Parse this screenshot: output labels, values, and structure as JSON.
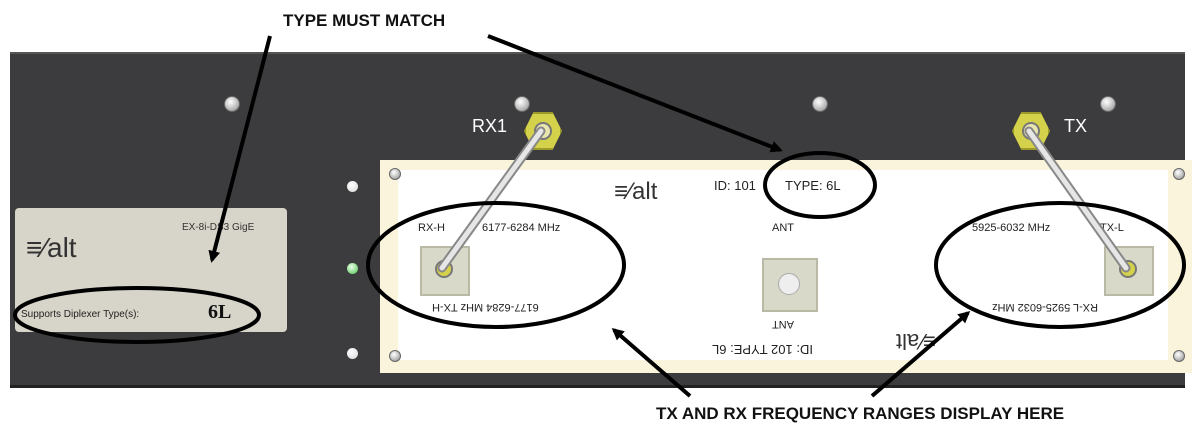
{
  "callouts": {
    "top": "TYPE MUST MATCH",
    "bottom": "TX AND RX FREQUENCY RANGES DISPLAY HERE"
  },
  "label_card": {
    "logo": "≡⁄alt",
    "model": "EX-8i-DS3 GigE",
    "supports_text": "Supports Diplexer Type(s):",
    "type_value": "6L"
  },
  "ports": {
    "rx1": "RX1",
    "tx": "TX",
    "ant_top": "ANT",
    "ant_bottom": "ANT"
  },
  "plate": {
    "logo": "≡⁄alt",
    "id_top": "ID: 101",
    "type_top": "TYPE: 6L",
    "rx_h": "RX-H",
    "rx_h_freq": "6177-6284 MHz",
    "tx_l_freq": "5925-6032 MHz",
    "tx_l": "TX-L",
    "tx_h_inverted": "6177-6284 MHz  TX-H",
    "rx_l_inverted": "RX-L  5925-6032 MHz",
    "id_bottom_inverted": "ID: 102  TYPE: 6L"
  },
  "colors": {
    "panel": "#3c3c3e",
    "plate": "#fbf4dc",
    "label_card": "#d7d4c9",
    "connector_nut": "#d4d24a"
  }
}
